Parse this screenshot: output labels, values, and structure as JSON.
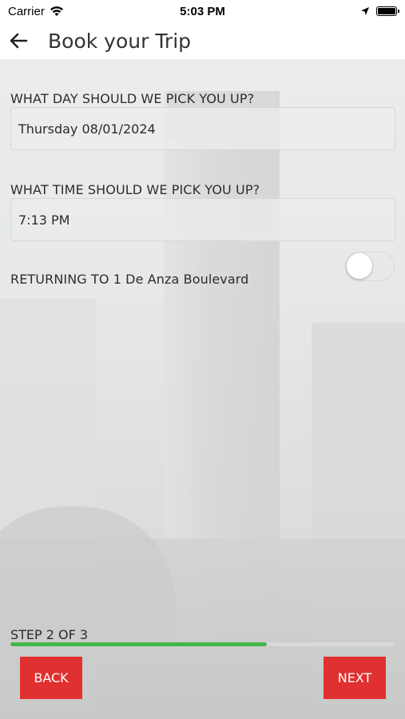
{
  "status_bar": {
    "carrier": "Carrier",
    "time": "5:03 PM"
  },
  "nav": {
    "title": "Book your Trip"
  },
  "form": {
    "day_label": "WHAT DAY SHOULD WE PICK YOU UP?",
    "day_value": "Thursday 08/01/2024",
    "time_label": "WHAT TIME SHOULD WE PICK YOU UP?",
    "time_value": "7:13 PM",
    "return_label": "RETURNING TO 1 De Anza Boulevard",
    "return_toggle_on": false
  },
  "progress": {
    "step_label": "STEP 2 OF 3",
    "fraction": 0.667,
    "color": "#44b649"
  },
  "buttons": {
    "back_label": "BACK",
    "next_label": "NEXT",
    "color": "#e0302f"
  }
}
